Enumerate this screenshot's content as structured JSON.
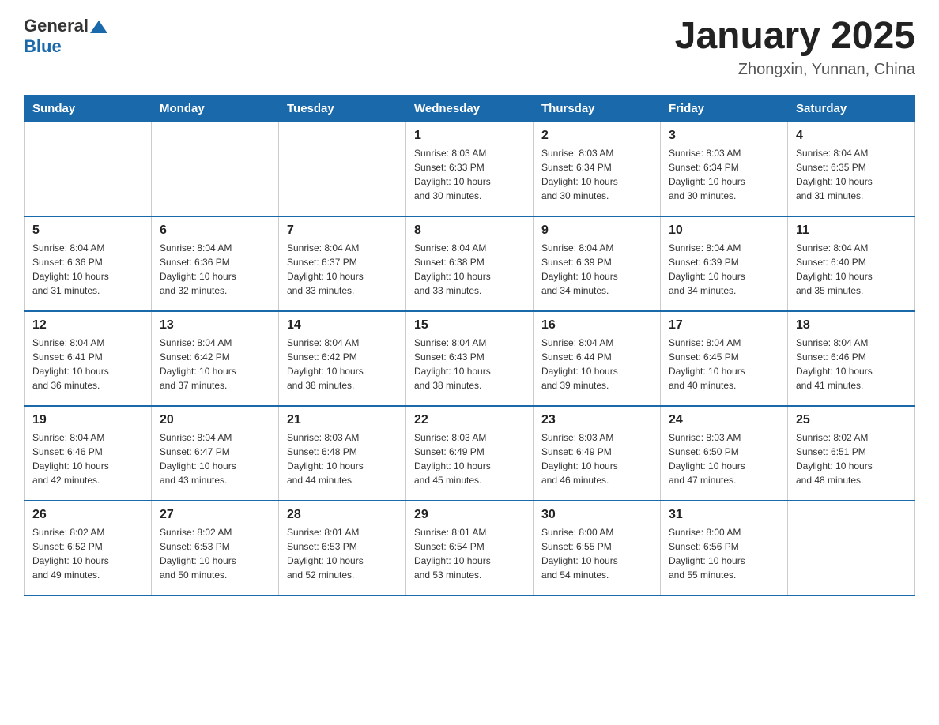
{
  "header": {
    "logo_general": "General",
    "logo_blue": "Blue",
    "title": "January 2025",
    "subtitle": "Zhongxin, Yunnan, China"
  },
  "days_of_week": [
    "Sunday",
    "Monday",
    "Tuesday",
    "Wednesday",
    "Thursday",
    "Friday",
    "Saturday"
  ],
  "weeks": [
    [
      {
        "day": "",
        "info": ""
      },
      {
        "day": "",
        "info": ""
      },
      {
        "day": "",
        "info": ""
      },
      {
        "day": "1",
        "info": "Sunrise: 8:03 AM\nSunset: 6:33 PM\nDaylight: 10 hours\nand 30 minutes."
      },
      {
        "day": "2",
        "info": "Sunrise: 8:03 AM\nSunset: 6:34 PM\nDaylight: 10 hours\nand 30 minutes."
      },
      {
        "day": "3",
        "info": "Sunrise: 8:03 AM\nSunset: 6:34 PM\nDaylight: 10 hours\nand 30 minutes."
      },
      {
        "day": "4",
        "info": "Sunrise: 8:04 AM\nSunset: 6:35 PM\nDaylight: 10 hours\nand 31 minutes."
      }
    ],
    [
      {
        "day": "5",
        "info": "Sunrise: 8:04 AM\nSunset: 6:36 PM\nDaylight: 10 hours\nand 31 minutes."
      },
      {
        "day": "6",
        "info": "Sunrise: 8:04 AM\nSunset: 6:36 PM\nDaylight: 10 hours\nand 32 minutes."
      },
      {
        "day": "7",
        "info": "Sunrise: 8:04 AM\nSunset: 6:37 PM\nDaylight: 10 hours\nand 33 minutes."
      },
      {
        "day": "8",
        "info": "Sunrise: 8:04 AM\nSunset: 6:38 PM\nDaylight: 10 hours\nand 33 minutes."
      },
      {
        "day": "9",
        "info": "Sunrise: 8:04 AM\nSunset: 6:39 PM\nDaylight: 10 hours\nand 34 minutes."
      },
      {
        "day": "10",
        "info": "Sunrise: 8:04 AM\nSunset: 6:39 PM\nDaylight: 10 hours\nand 34 minutes."
      },
      {
        "day": "11",
        "info": "Sunrise: 8:04 AM\nSunset: 6:40 PM\nDaylight: 10 hours\nand 35 minutes."
      }
    ],
    [
      {
        "day": "12",
        "info": "Sunrise: 8:04 AM\nSunset: 6:41 PM\nDaylight: 10 hours\nand 36 minutes."
      },
      {
        "day": "13",
        "info": "Sunrise: 8:04 AM\nSunset: 6:42 PM\nDaylight: 10 hours\nand 37 minutes."
      },
      {
        "day": "14",
        "info": "Sunrise: 8:04 AM\nSunset: 6:42 PM\nDaylight: 10 hours\nand 38 minutes."
      },
      {
        "day": "15",
        "info": "Sunrise: 8:04 AM\nSunset: 6:43 PM\nDaylight: 10 hours\nand 38 minutes."
      },
      {
        "day": "16",
        "info": "Sunrise: 8:04 AM\nSunset: 6:44 PM\nDaylight: 10 hours\nand 39 minutes."
      },
      {
        "day": "17",
        "info": "Sunrise: 8:04 AM\nSunset: 6:45 PM\nDaylight: 10 hours\nand 40 minutes."
      },
      {
        "day": "18",
        "info": "Sunrise: 8:04 AM\nSunset: 6:46 PM\nDaylight: 10 hours\nand 41 minutes."
      }
    ],
    [
      {
        "day": "19",
        "info": "Sunrise: 8:04 AM\nSunset: 6:46 PM\nDaylight: 10 hours\nand 42 minutes."
      },
      {
        "day": "20",
        "info": "Sunrise: 8:04 AM\nSunset: 6:47 PM\nDaylight: 10 hours\nand 43 minutes."
      },
      {
        "day": "21",
        "info": "Sunrise: 8:03 AM\nSunset: 6:48 PM\nDaylight: 10 hours\nand 44 minutes."
      },
      {
        "day": "22",
        "info": "Sunrise: 8:03 AM\nSunset: 6:49 PM\nDaylight: 10 hours\nand 45 minutes."
      },
      {
        "day": "23",
        "info": "Sunrise: 8:03 AM\nSunset: 6:49 PM\nDaylight: 10 hours\nand 46 minutes."
      },
      {
        "day": "24",
        "info": "Sunrise: 8:03 AM\nSunset: 6:50 PM\nDaylight: 10 hours\nand 47 minutes."
      },
      {
        "day": "25",
        "info": "Sunrise: 8:02 AM\nSunset: 6:51 PM\nDaylight: 10 hours\nand 48 minutes."
      }
    ],
    [
      {
        "day": "26",
        "info": "Sunrise: 8:02 AM\nSunset: 6:52 PM\nDaylight: 10 hours\nand 49 minutes."
      },
      {
        "day": "27",
        "info": "Sunrise: 8:02 AM\nSunset: 6:53 PM\nDaylight: 10 hours\nand 50 minutes."
      },
      {
        "day": "28",
        "info": "Sunrise: 8:01 AM\nSunset: 6:53 PM\nDaylight: 10 hours\nand 52 minutes."
      },
      {
        "day": "29",
        "info": "Sunrise: 8:01 AM\nSunset: 6:54 PM\nDaylight: 10 hours\nand 53 minutes."
      },
      {
        "day": "30",
        "info": "Sunrise: 8:00 AM\nSunset: 6:55 PM\nDaylight: 10 hours\nand 54 minutes."
      },
      {
        "day": "31",
        "info": "Sunrise: 8:00 AM\nSunset: 6:56 PM\nDaylight: 10 hours\nand 55 minutes."
      },
      {
        "day": "",
        "info": ""
      }
    ]
  ]
}
